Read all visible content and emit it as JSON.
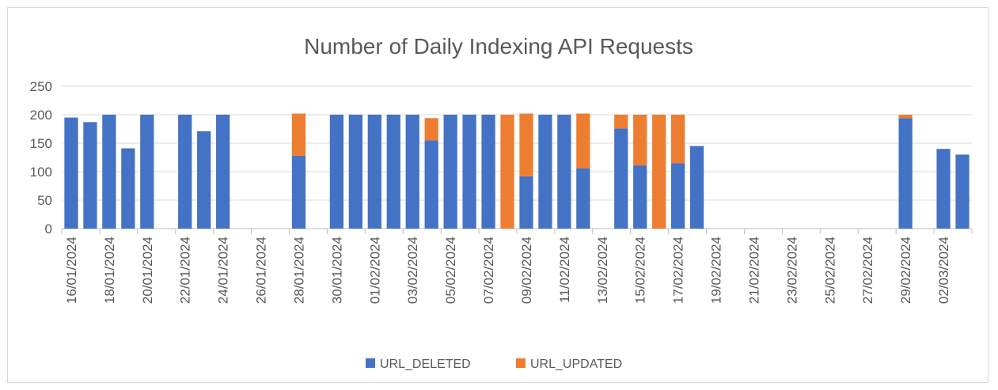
{
  "chart_data": {
    "type": "bar",
    "stacked": true,
    "title": "Number of Daily Indexing API Requests",
    "xlabel": "",
    "ylabel": "",
    "ylim": [
      0,
      250
    ],
    "yticks": [
      "0",
      "50",
      "100",
      "150",
      "200",
      "250"
    ],
    "grid": true,
    "legend_position": "bottom",
    "colors": {
      "URL_DELETED": "#4472C4",
      "URL_UPDATED": "#ED7D31"
    },
    "categories": [
      "16/01/2024",
      "17/01/2024",
      "18/01/2024",
      "19/01/2024",
      "20/01/2024",
      "21/01/2024",
      "22/01/2024",
      "23/01/2024",
      "24/01/2024",
      "25/01/2024",
      "26/01/2024",
      "27/01/2024",
      "28/01/2024",
      "29/01/2024",
      "30/01/2024",
      "31/01/2024",
      "01/02/2024",
      "02/02/2024",
      "03/02/2024",
      "04/02/2024",
      "05/02/2024",
      "06/02/2024",
      "07/02/2024",
      "08/02/2024",
      "09/02/2024",
      "10/02/2024",
      "11/02/2024",
      "12/02/2024",
      "13/02/2024",
      "14/02/2024",
      "15/02/2024",
      "16/02/2024",
      "17/02/2024",
      "18/02/2024",
      "19/02/2024",
      "20/02/2024",
      "21/02/2024",
      "22/02/2024",
      "23/02/2024",
      "24/02/2024",
      "25/02/2024",
      "26/02/2024",
      "27/02/2024",
      "28/02/2024",
      "29/02/2024",
      "01/03/2024",
      "02/03/2024",
      "03/03/2024"
    ],
    "tick_labels": [
      "16/01/2024",
      "18/01/2024",
      "20/01/2024",
      "22/01/2024",
      "24/01/2024",
      "26/01/2024",
      "28/01/2024",
      "30/01/2024",
      "01/02/2024",
      "03/02/2024",
      "05/02/2024",
      "07/02/2024",
      "09/02/2024",
      "11/02/2024",
      "13/02/2024",
      "15/02/2024",
      "17/02/2024",
      "19/02/2024",
      "21/02/2024",
      "23/02/2024",
      "25/02/2024",
      "27/02/2024",
      "29/02/2024",
      "02/03/2024"
    ],
    "series": [
      {
        "name": "URL_DELETED",
        "values": [
          195,
          187,
          200,
          141,
          200,
          0,
          200,
          171,
          200,
          0,
          0,
          0,
          128,
          0,
          200,
          200,
          200,
          200,
          200,
          155,
          200,
          200,
          200,
          0,
          92,
          200,
          200,
          106,
          0,
          176,
          111,
          0,
          115,
          145,
          0,
          0,
          0,
          0,
          0,
          0,
          0,
          0,
          0,
          0,
          194,
          0,
          140,
          130
        ]
      },
      {
        "name": "URL_UPDATED",
        "values": [
          0,
          0,
          0,
          0,
          0,
          0,
          0,
          0,
          0,
          0,
          0,
          0,
          74,
          0,
          0,
          0,
          0,
          0,
          0,
          39,
          0,
          0,
          0,
          200,
          110,
          0,
          0,
          96,
          0,
          24,
          89,
          200,
          85,
          0,
          0,
          0,
          0,
          0,
          0,
          0,
          0,
          0,
          0,
          0,
          6,
          0,
          0,
          0
        ]
      }
    ]
  }
}
